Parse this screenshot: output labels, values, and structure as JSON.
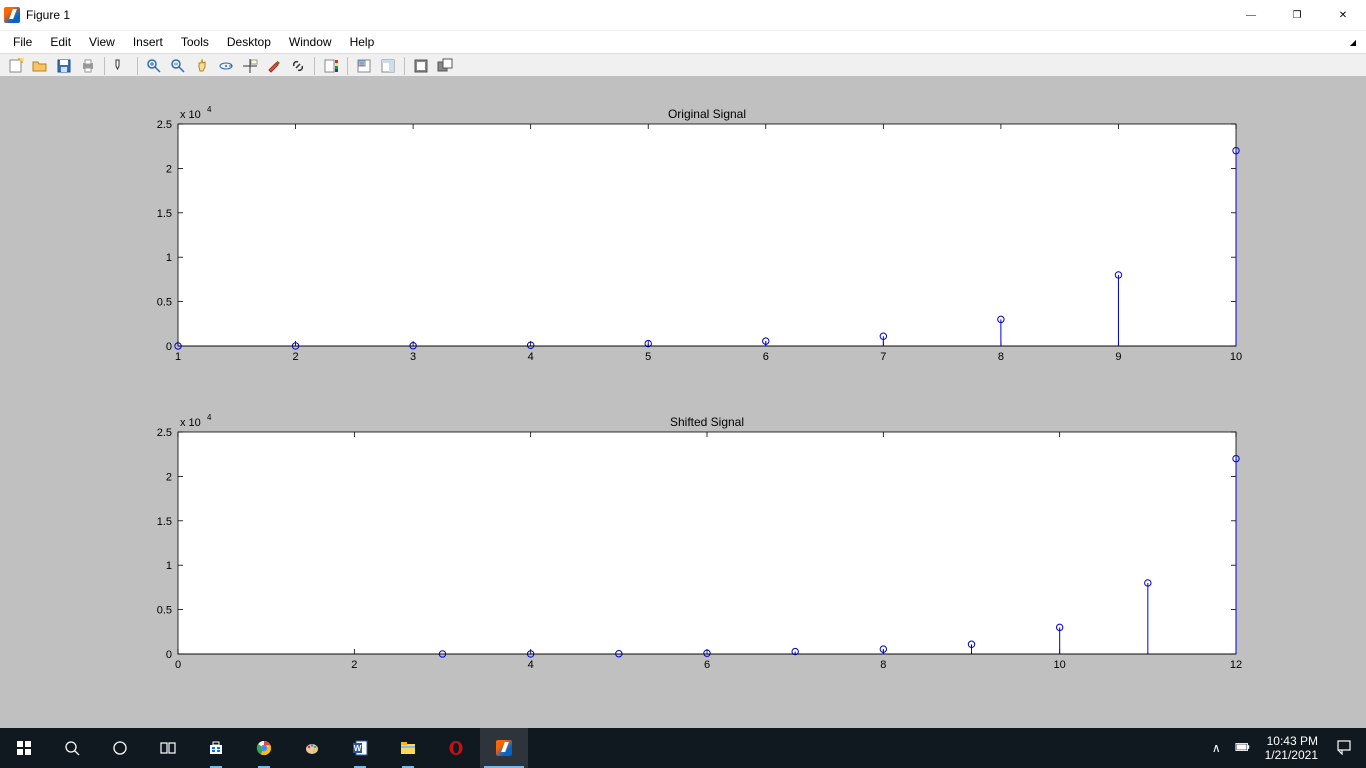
{
  "window": {
    "title": "Figure 1"
  },
  "menubar": [
    "File",
    "Edit",
    "View",
    "Insert",
    "Tools",
    "Desktop",
    "Window",
    "Help"
  ],
  "toolbar_icons": [
    "new-figure",
    "open",
    "save",
    "print",
    "sep",
    "edit-plot",
    "sep",
    "zoom-in",
    "zoom-out",
    "pan",
    "rotate-3d",
    "data-cursor",
    "brush",
    "link",
    "sep",
    "insert-colorbar",
    "sep",
    "insert-legend",
    "hide-tools",
    "sep",
    "dock",
    "undock"
  ],
  "system": {
    "time": "10:43 PM",
    "date": "1/21/2021"
  },
  "chart_data": [
    {
      "type": "stem",
      "title": "Original Signal",
      "x": [
        1,
        2,
        3,
        4,
        5,
        6,
        7,
        8,
        9,
        10
      ],
      "y": [
        3,
        9,
        30,
        90,
        270,
        550,
        1100,
        3000,
        8000,
        22000
      ],
      "xlim": [
        1,
        10
      ],
      "ylim": [
        0,
        25000
      ],
      "xticks": [
        1,
        2,
        3,
        4,
        5,
        6,
        7,
        8,
        9,
        10
      ],
      "yticks": [
        0,
        0.5,
        1,
        1.5,
        2,
        2.5
      ],
      "ytick_labels": [
        "0",
        "0.5",
        "1",
        "1.5",
        "2",
        "2.5"
      ],
      "ymult_label": "x 10",
      "ymult_exp": "4"
    },
    {
      "type": "stem",
      "title": "Shifted Signal",
      "x": [
        3,
        4,
        5,
        6,
        7,
        8,
        9,
        10,
        11,
        12
      ],
      "y": [
        3,
        9,
        30,
        90,
        270,
        550,
        1100,
        3000,
        8000,
        22000
      ],
      "xlim": [
        0,
        12
      ],
      "ylim": [
        0,
        25000
      ],
      "xticks": [
        0,
        2,
        4,
        6,
        8,
        10,
        12
      ],
      "yticks": [
        0,
        0.5,
        1,
        1.5,
        2,
        2.5
      ],
      "ytick_labels": [
        "0",
        "0.5",
        "1",
        "1.5",
        "2",
        "2.5"
      ],
      "ymult_label": "x 10",
      "ymult_exp": "4"
    }
  ]
}
